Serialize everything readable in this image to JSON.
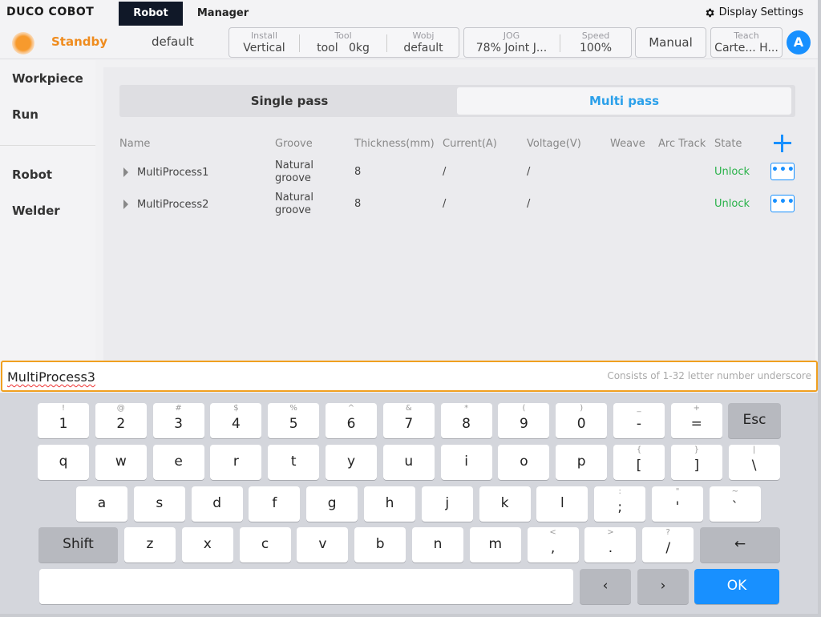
{
  "topbar": {
    "brand": "DUCO COBOT",
    "tabs": [
      "Robot",
      "Manager"
    ],
    "display_settings": "Display Settings"
  },
  "statusbar": {
    "status": "Standby",
    "profile": "default",
    "install_label": "Install",
    "install_value": "Vertical",
    "tool_label": "Tool",
    "tool_value": "tool",
    "tool_load": "0kg",
    "wobj_label": "Wobj",
    "wobj_value": "default",
    "jog_label": "JOG",
    "jog_value": "78%  Joint J...",
    "speed_label": "Speed",
    "speed_value": "100%",
    "manual": "Manual",
    "teach_label": "Teach",
    "teach_value": "Carte... H...",
    "avatar": "A"
  },
  "sidebar": {
    "workpiece": "Workpiece",
    "run": "Run",
    "robot": "Robot",
    "welder": "Welder"
  },
  "main": {
    "tab_single": "Single pass",
    "tab_multi": "Multi pass",
    "columns": [
      "Name",
      "Groove",
      "Thickness(mm)",
      "Current(A)",
      "Voltage(V)",
      "Weave",
      "Arc Track",
      "State"
    ],
    "rows": [
      {
        "name": "MultiProcess1",
        "groove1": "Natural",
        "groove2": "groove",
        "thickness": "8",
        "current": "/",
        "voltage": "/",
        "state": "Unlock",
        "more": "•••"
      },
      {
        "name": "MultiProcess2",
        "groove1": "Natural",
        "groove2": "groove",
        "thickness": "8",
        "current": "/",
        "voltage": "/",
        "state": "Unlock",
        "more": "•••"
      }
    ]
  },
  "input": {
    "value": "MultiProcess3",
    "hint": "Consists of 1-32 letter number underscore"
  },
  "keyboard": {
    "row1": [
      {
        "main": "1",
        "sym": "!"
      },
      {
        "main": "2",
        "sym": "@"
      },
      {
        "main": "3",
        "sym": "#"
      },
      {
        "main": "4",
        "sym": "$"
      },
      {
        "main": "5",
        "sym": "%"
      },
      {
        "main": "6",
        "sym": "^"
      },
      {
        "main": "7",
        "sym": "&"
      },
      {
        "main": "8",
        "sym": "*"
      },
      {
        "main": "9",
        "sym": "("
      },
      {
        "main": "0",
        "sym": ")"
      },
      {
        "main": "-",
        "sym": "_"
      },
      {
        "main": "=",
        "sym": "+"
      }
    ],
    "esc": "Esc",
    "row2": [
      {
        "main": "q"
      },
      {
        "main": "w"
      },
      {
        "main": "e"
      },
      {
        "main": "r"
      },
      {
        "main": "t"
      },
      {
        "main": "y"
      },
      {
        "main": "u"
      },
      {
        "main": "i"
      },
      {
        "main": "o"
      },
      {
        "main": "p"
      },
      {
        "main": "[",
        "sym": "{"
      },
      {
        "main": "]",
        "sym": "}"
      },
      {
        "main": "\\",
        "sym": "|"
      }
    ],
    "row3": [
      {
        "main": "a"
      },
      {
        "main": "s"
      },
      {
        "main": "d"
      },
      {
        "main": "f"
      },
      {
        "main": "g"
      },
      {
        "main": "h"
      },
      {
        "main": "j"
      },
      {
        "main": "k"
      },
      {
        "main": "l"
      },
      {
        "main": ";",
        "sym": ":"
      },
      {
        "main": "'",
        "sym": "\""
      },
      {
        "main": "`",
        "sym": "~"
      }
    ],
    "shift": "Shift",
    "row4": [
      {
        "main": "z"
      },
      {
        "main": "x"
      },
      {
        "main": "c"
      },
      {
        "main": "v"
      },
      {
        "main": "b"
      },
      {
        "main": "n"
      },
      {
        "main": "m"
      },
      {
        "main": ",",
        "sym": "<"
      },
      {
        "main": ".",
        "sym": ">"
      },
      {
        "main": "/",
        "sym": "?"
      }
    ],
    "backspace": "←",
    "left": "‹",
    "right": "›",
    "ok": "OK"
  },
  "colors": {
    "accent": "#1890ff",
    "status": "#ef8c1f",
    "unlock": "#2ab24a",
    "input_border": "#f0a020"
  }
}
